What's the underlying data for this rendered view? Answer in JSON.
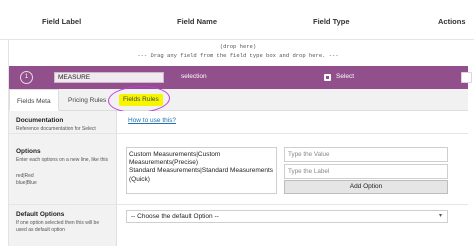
{
  "table_header": {
    "field_label": "Field Label",
    "field_name": "Field Name",
    "field_type": "Field Type",
    "actions": "Actions"
  },
  "drop_zone": {
    "line1": "(drop here)",
    "line2": "--- Drag any field from the field type box and drop here. ---"
  },
  "field": {
    "order": "1",
    "name_value": "MEASURE",
    "type": "selection",
    "type_button": "Select"
  },
  "tabs": {
    "meta": "Fields Meta",
    "pricing": "Pricing Rules",
    "rules": "Fields Rules"
  },
  "documentation": {
    "heading": "Documentation",
    "desc": "Reference documentation for Select",
    "link": "How to use this?"
  },
  "options": {
    "heading": "Options",
    "desc": "Enter each options on a new line, like this",
    "example1": "red|Red",
    "example2": "blue|Blue",
    "textarea_line1": "Custom Measurements|Custom",
    "textarea_line2": "Measurements(Precise)",
    "textarea_line3": "Standard Measurements|Standard Measurements",
    "textarea_line4": "(Quick)",
    "value_placeholder": "Type the Value",
    "label_placeholder": "Type the Label",
    "add_button": "Add Option"
  },
  "default_options": {
    "heading": "Default Options",
    "desc1": "If one option selected then this will be",
    "desc2": "used as default option",
    "select_value": "-- Choose the default Option --"
  },
  "colors": {
    "accent_bar": "#914f8c",
    "highlight": "#f6f600",
    "annotation": "#c23bd6",
    "link": "#2271b1"
  }
}
